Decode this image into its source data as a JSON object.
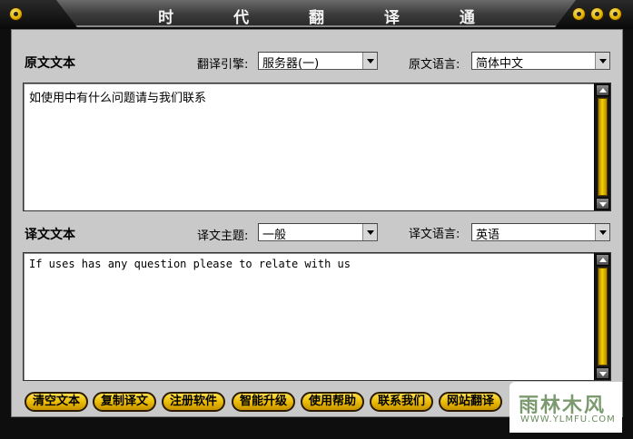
{
  "window": {
    "title": "时 代 翻 译 通"
  },
  "source": {
    "heading": "原文文本",
    "engine_label": "翻译引擎:",
    "engine_value": "服务器(一)",
    "lang_label": "原文语言:",
    "lang_value": "简体中文",
    "text": "如使用中有什么问题请与我们联系"
  },
  "target": {
    "heading": "译文文本",
    "topic_label": "译文主题:",
    "topic_value": "一般",
    "lang_label": "译文语言:",
    "lang_value": "英语",
    "text": "If uses has any question please to relate with us"
  },
  "buttons": {
    "clear": "清空文本",
    "copy": "复制译文",
    "register": "注册软件",
    "upgrade": "智能升级",
    "help": "使用帮助",
    "contact": "联系我们",
    "web_translate": "网站翻译"
  },
  "watermark": {
    "name": "雨林木风",
    "url": "WWW.YLMFU.COM"
  },
  "colors": {
    "accent": "#f0c400",
    "panel": "#c9c9c9",
    "frame": "#0e0e0e"
  }
}
